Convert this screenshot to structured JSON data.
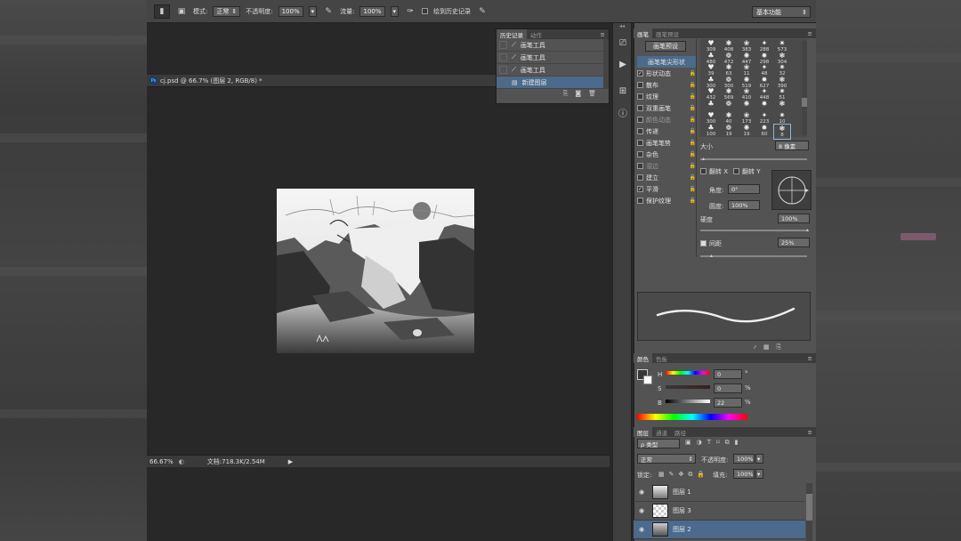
{
  "options_bar": {
    "mode_label": "模式:",
    "mode_value": "正常",
    "opacity_label": "不透明度:",
    "opacity_value": "100%",
    "flow_label": "流量:",
    "flow_value": "100%",
    "history_checkbox_label": "绘到历史记录",
    "workspace": "基本功能"
  },
  "document": {
    "tab_title": "cj.psd @ 66.7% (图层 2, RGB/8) *",
    "zoom": "66.67%",
    "doc_info": "文档:718.3K/2.54M"
  },
  "history_panel": {
    "tabs": [
      "历史记录",
      "动作"
    ],
    "rows": [
      "画笔工具",
      "画笔工具",
      "画笔工具",
      "新建图层"
    ]
  },
  "brush_panel": {
    "tabs": [
      "画笔",
      "画笔预设"
    ],
    "preset_button": "画笔预设",
    "options": [
      {
        "label": "画笔笔尖形状",
        "checked": null
      },
      {
        "label": "形状动态",
        "checked": true
      },
      {
        "label": "散布",
        "checked": false
      },
      {
        "label": "纹理",
        "checked": false
      },
      {
        "label": "双重画笔",
        "checked": false
      },
      {
        "label": "颜色动态",
        "checked": false,
        "dim": true
      },
      {
        "label": "传递",
        "checked": false
      },
      {
        "label": "画笔笔势",
        "checked": false
      },
      {
        "label": "杂色",
        "checked": false
      },
      {
        "label": "湿边",
        "checked": false,
        "dim": true
      },
      {
        "label": "建立",
        "checked": false
      },
      {
        "label": "平滑",
        "checked": true
      },
      {
        "label": "保护纹理",
        "checked": false
      }
    ],
    "tip_sizes": [
      "309",
      "408",
      "383",
      "288",
      "573",
      "480",
      "472",
      "447",
      "298",
      "304",
      "39",
      "63",
      "11",
      "48",
      "32",
      "300",
      "300",
      "519",
      "627",
      "390",
      "432",
      "569",
      "410",
      "448",
      "51",
      "",
      "",
      "",
      "",
      "",
      "300",
      "40",
      "173",
      "223",
      "10",
      "100",
      "19",
      "19",
      "60",
      "8"
    ],
    "size_label": "大小",
    "size_value": "8 像素",
    "flip_x": "翻转 X",
    "flip_y": "翻转 Y",
    "angle_label": "角度:",
    "angle_value": "0°",
    "roundness_label": "圆度:",
    "roundness_value": "100%",
    "hardness_label": "硬度",
    "hardness_value": "100%",
    "spacing_label": "间距",
    "spacing_value": "25%"
  },
  "color_panel": {
    "tabs": [
      "颜色",
      "色板"
    ],
    "h_label": "H",
    "h_value": "0",
    "h_unit": "°",
    "s_label": "S",
    "s_value": "0",
    "s_unit": "%",
    "b_label": "B",
    "b_value": "22",
    "b_unit": "%"
  },
  "layers_panel": {
    "tabs": [
      "图层",
      "通道",
      "路径"
    ],
    "filter_label": "ρ 类型",
    "blend_mode": "正常",
    "opacity_label": "不透明度:",
    "opacity_value": "100%",
    "lock_label": "锁定:",
    "fill_label": "填充:",
    "fill_value": "100%",
    "layers": [
      {
        "name": "图层 1",
        "active": false
      },
      {
        "name": "图层 3",
        "active": false
      },
      {
        "name": "图层 2",
        "active": true
      }
    ]
  }
}
